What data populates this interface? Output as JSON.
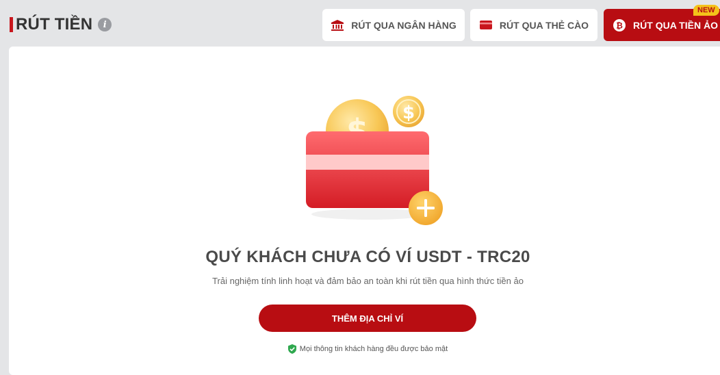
{
  "header": {
    "title": "RÚT TIỀN",
    "info_icon": "info-icon"
  },
  "tabs": [
    {
      "label": "RÚT QUA NGÂN HÀNG",
      "icon": "bank-icon",
      "active": false
    },
    {
      "label": "RÚT QUA THẺ CÀO",
      "icon": "card-icon",
      "active": false
    },
    {
      "label": "RÚT QUA TIỀN ẢO",
      "icon": "bitcoin-icon",
      "active": true,
      "badge": "NEW"
    }
  ],
  "empty_state": {
    "title": "QUÝ KHÁCH CHƯA CÓ VÍ USDT - TRC20",
    "description": "Trải nghiệm tính linh hoạt và đảm bảo an toàn khi rút tiền qua hình thức tiền ảo",
    "button_label": "THÊM ĐỊA CHỈ VÍ",
    "security_note": "Mọi thông tin khách hàng đều được bảo mật"
  },
  "colors": {
    "brand_red": "#b80d12",
    "badge_yellow": "#f4c21a",
    "secure_green": "#2fa84f"
  }
}
